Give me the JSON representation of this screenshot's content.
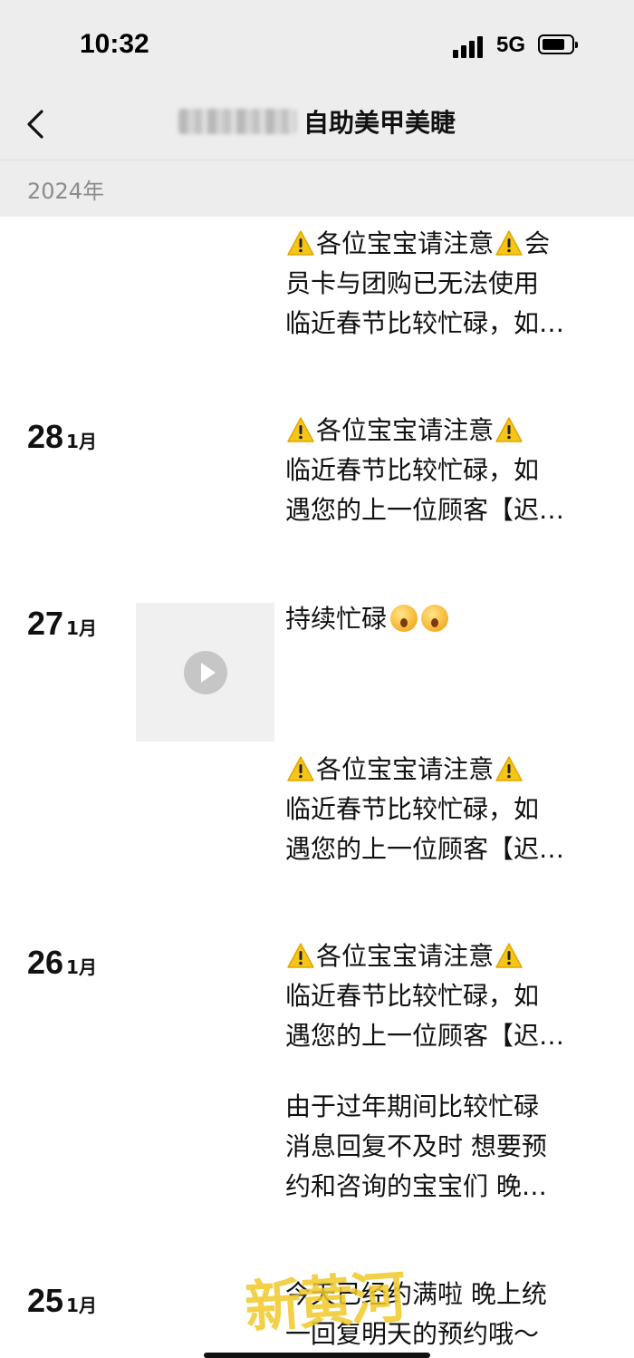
{
  "status": {
    "time": "10:32",
    "network": "5G"
  },
  "nav": {
    "title": "自助美甲美睫",
    "back_icon": "chevron-left-icon"
  },
  "year_label": "2024年",
  "posts": [
    {
      "day": "",
      "month": "",
      "lines": [
        "⚠各位宝宝请注意⚠会",
        "员卡与团购已无法使用",
        "临近春节比较忙碌，如…"
      ]
    },
    {
      "day": "28",
      "month": "1月",
      "lines": [
        "⚠各位宝宝请注意⚠",
        "临近春节比较忙碌，如",
        "遇您的上一位顾客【迟…"
      ]
    },
    {
      "day": "27",
      "month": "1月",
      "lines": [
        "持续忙碌😮😮"
      ],
      "video": true
    },
    {
      "day": "",
      "month": "",
      "lines": [
        "⚠各位宝宝请注意⚠",
        "临近春节比较忙碌，如",
        "遇您的上一位顾客【迟…"
      ]
    },
    {
      "day": "26",
      "month": "1月",
      "lines": [
        "⚠各位宝宝请注意⚠",
        "临近春节比较忙碌，如",
        "遇您的上一位顾客【迟…"
      ]
    },
    {
      "day": "",
      "month": "",
      "lines": [
        "由于过年期间比较忙碌",
        "消息回复不及时 想要预",
        "约和咨询的宝宝们 晚…"
      ]
    },
    {
      "day": "25",
      "month": "1月",
      "lines": [
        "今天已经约满啦 晚上统",
        "一回复明天的预约哦～"
      ]
    }
  ],
  "watermark": "新黄河",
  "colors": {
    "background": "#ededed",
    "warning": "#f5c518"
  }
}
